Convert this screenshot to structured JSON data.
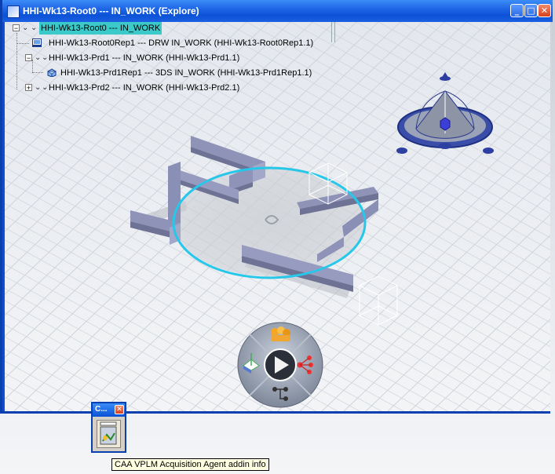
{
  "window": {
    "title": "HHI-Wk13-Root0 --- IN_WORK (Explore)",
    "minimize_glyph": "_",
    "maximize_glyph": "□",
    "close_glyph": "✕"
  },
  "tree": [
    {
      "label": "HHI-Wk13-Root0 --- IN_WORK",
      "selected": true,
      "icon": "product-root-icon",
      "expander": "−"
    },
    {
      "label": "HHI-Wk13-Root0Rep1 --- DRW IN_WORK (HHI-Wk13-Root0Rep1.1)",
      "icon": "drawing-representation-icon"
    },
    {
      "label": "HHI-Wk13-Prd1 --- IN_WORK (HHI-Wk13-Prd1.1)",
      "icon": "product-icon",
      "expander": "−"
    },
    {
      "label": "HHI-Wk13-Prd1Rep1 --- 3DS IN_WORK (HHI-Wk13-Prd1Rep1.1)",
      "icon": "3d-shape-representation-icon"
    },
    {
      "label": "HHI-Wk13-Prd2 --- IN_WORK (HHI-Wk13-Prd2.1)",
      "icon": "product-icon",
      "expander": "+"
    }
  ],
  "mini_window": {
    "title": "C...",
    "close_glyph": "✕"
  },
  "tooltip": "CAA VPLM Acquisition Agent addin info",
  "colors": {
    "selection": "#3cc9c9",
    "title_bar": "#0b52d6",
    "beams": "#8a8fb5",
    "robot_ring": "#27c7ea"
  }
}
